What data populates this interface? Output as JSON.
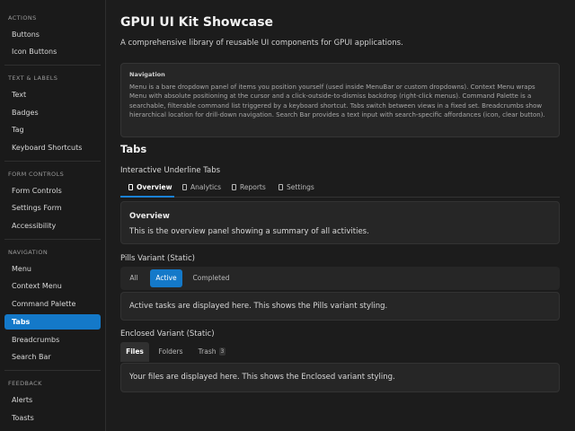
{
  "sidebar": {
    "sections": [
      {
        "title": "ACTIONS",
        "items": [
          "Buttons",
          "Icon Buttons"
        ]
      },
      {
        "title": "TEXT & LABELS",
        "items": [
          "Text",
          "Badges",
          "Tag",
          "Keyboard Shortcuts"
        ]
      },
      {
        "title": "FORM CONTROLS",
        "items": [
          "Form Controls",
          "Settings Form",
          "Accessibility"
        ]
      },
      {
        "title": "NAVIGATION",
        "items": [
          "Menu",
          "Context Menu",
          "Command Palette",
          "Tabs",
          "Breadcrumbs",
          "Search Bar"
        ]
      },
      {
        "title": "FEEDBACK",
        "items": [
          "Alerts",
          "Toasts"
        ]
      }
    ],
    "active_item": "Tabs"
  },
  "header": {
    "title": "GPUI UI Kit Showcase",
    "subtitle": "A comprehensive library of reusable UI components for GPUI applications."
  },
  "nav_info": {
    "title": "Navigation",
    "text": "Menu is a bare dropdown panel of items you position yourself (used inside MenuBar or custom dropdowns). Context Menu wraps Menu with absolute positioning at the cursor and a click-outside-to-dismiss backdrop (right-click menus). Command Palette is a searchable, filterable command list triggered by a keyboard shortcut. Tabs switch between views in a fixed set. Breadcrumbs show hierarchical location for drill-down navigation. Search Bar provides a text input with search-specific affordances (icon, clear button)."
  },
  "tabs_section": {
    "heading": "Tabs",
    "underline": {
      "label": "Interactive Underline Tabs",
      "tabs": [
        "Overview",
        "Analytics",
        "Reports",
        "Settings"
      ],
      "active": "Overview",
      "panel_title": "Overview",
      "panel_text": "This is the overview panel showing a summary of all activities."
    },
    "pills": {
      "label": "Pills Variant (Static)",
      "tabs": [
        "All",
        "Active",
        "Completed"
      ],
      "active": "Active",
      "panel_text": "Active tasks are displayed here. This shows the Pills variant styling."
    },
    "enclosed": {
      "label": "Enclosed Variant (Static)",
      "tabs": [
        "Files",
        "Folders",
        "Trash"
      ],
      "trash_badge": "3",
      "active": "Files",
      "panel_text": "Your files are displayed here. This shows the Enclosed variant styling."
    }
  }
}
